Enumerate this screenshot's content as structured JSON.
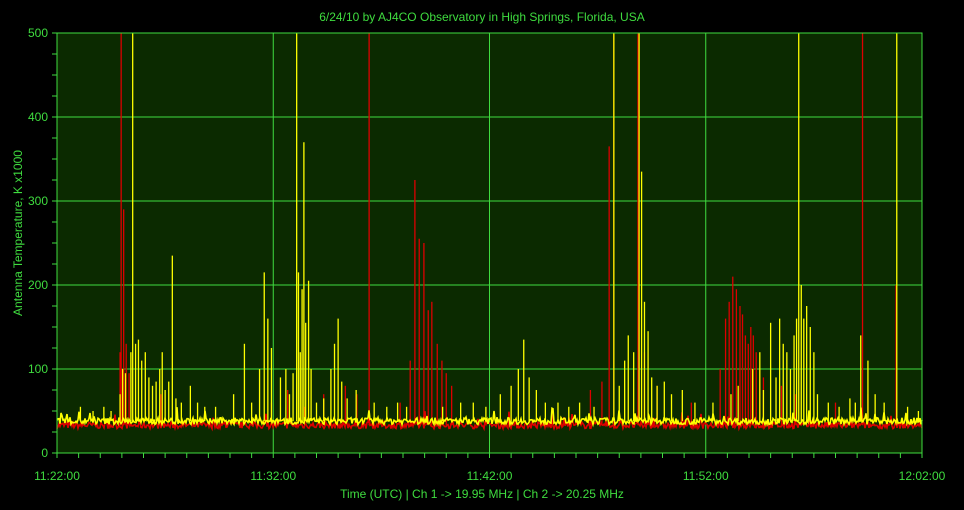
{
  "chart_data": {
    "type": "line",
    "title": "6/24/10  by  AJ4CO Observatory  in  High Springs, Florida, USA",
    "xlabel": "Time (UTC)  |  Ch 1 -> 19.95 MHz  |  Ch 2 -> 20.25 MHz",
    "ylabel": "Antenna Temperature, K x1000",
    "ylim": [
      0,
      500
    ],
    "yticks": [
      0,
      100,
      200,
      300,
      400,
      500
    ],
    "xlim": [
      "11:22:00",
      "12:02:00"
    ],
    "xticks": [
      "11:22:00",
      "11:32:00",
      "11:42:00",
      "11:52:00",
      "12:02:00"
    ],
    "grid": true,
    "background": "#0b2a00",
    "series": [
      {
        "color": "#dd0000",
        "baseline": 33,
        "points": [
          [
            "11:24:55",
            120
          ],
          [
            "11:24:58",
            500
          ],
          [
            "11:25:05",
            290
          ],
          [
            "11:25:12",
            130
          ],
          [
            "11:25:20",
            95
          ],
          [
            "11:26:15",
            75
          ],
          [
            "11:26:48",
            70
          ],
          [
            "11:31:55",
            60
          ],
          [
            "11:32:40",
            75
          ],
          [
            "11:33:28",
            55
          ],
          [
            "11:34:20",
            70
          ],
          [
            "11:35:20",
            80
          ],
          [
            "11:35:52",
            70
          ],
          [
            "11:36:26",
            500
          ],
          [
            "11:37:52",
            60
          ],
          [
            "11:38:20",
            110
          ],
          [
            "11:38:33",
            325
          ],
          [
            "11:38:45",
            255
          ],
          [
            "11:38:58",
            250
          ],
          [
            "11:39:10",
            170
          ],
          [
            "11:39:20",
            180
          ],
          [
            "11:39:35",
            130
          ],
          [
            "11:39:48",
            110
          ],
          [
            "11:40:00",
            95
          ],
          [
            "11:40:15",
            80
          ],
          [
            "11:46:40",
            75
          ],
          [
            "11:47:12",
            85
          ],
          [
            "11:47:32",
            365
          ],
          [
            "11:47:45",
            500
          ],
          [
            "11:48:52",
            500
          ],
          [
            "11:49:10",
            120
          ],
          [
            "11:49:45",
            80
          ],
          [
            "11:51:20",
            60
          ],
          [
            "11:52:40",
            100
          ],
          [
            "11:52:55",
            160
          ],
          [
            "11:53:05",
            180
          ],
          [
            "11:53:15",
            210
          ],
          [
            "11:53:25",
            195
          ],
          [
            "11:53:35",
            175
          ],
          [
            "11:53:42",
            165
          ],
          [
            "11:53:50",
            140
          ],
          [
            "11:53:58",
            130
          ],
          [
            "11:54:05",
            150
          ],
          [
            "11:54:12",
            140
          ],
          [
            "11:54:20",
            120
          ],
          [
            "11:54:30",
            100
          ],
          [
            "11:54:40",
            90
          ],
          [
            "11:55:30",
            80
          ],
          [
            "11:56:10",
            70
          ],
          [
            "11:58:00",
            60
          ],
          [
            "11:59:15",
            500
          ],
          [
            "11:59:30",
            70
          ],
          [
            "12:00:48",
            200
          ]
        ]
      },
      {
        "color": "#ffff00",
        "baseline": 38,
        "points": [
          [
            "11:23:05",
            55
          ],
          [
            "11:23:40",
            50
          ],
          [
            "11:24:10",
            55
          ],
          [
            "11:24:30",
            50
          ],
          [
            "11:24:55",
            70
          ],
          [
            "11:25:02",
            100
          ],
          [
            "11:25:10",
            95
          ],
          [
            "11:25:25",
            120
          ],
          [
            "11:25:30",
            500
          ],
          [
            "11:25:38",
            130
          ],
          [
            "11:25:46",
            135
          ],
          [
            "11:25:55",
            110
          ],
          [
            "11:26:05",
            120
          ],
          [
            "11:26:15",
            90
          ],
          [
            "11:26:25",
            80
          ],
          [
            "11:26:35",
            85
          ],
          [
            "11:26:45",
            100
          ],
          [
            "11:26:52",
            120
          ],
          [
            "11:27:00",
            75
          ],
          [
            "11:27:10",
            85
          ],
          [
            "11:27:20",
            235
          ],
          [
            "11:27:30",
            65
          ],
          [
            "11:27:45",
            60
          ],
          [
            "11:28:10",
            80
          ],
          [
            "11:28:30",
            60
          ],
          [
            "11:28:50",
            55
          ],
          [
            "11:29:20",
            55
          ],
          [
            "11:30:10",
            70
          ],
          [
            "11:30:40",
            130
          ],
          [
            "11:31:00",
            60
          ],
          [
            "11:31:22",
            100
          ],
          [
            "11:31:35",
            215
          ],
          [
            "11:31:45",
            160
          ],
          [
            "11:31:55",
            125
          ],
          [
            "11:32:20",
            90
          ],
          [
            "11:32:35",
            100
          ],
          [
            "11:32:45",
            70
          ],
          [
            "11:32:55",
            95
          ],
          [
            "11:33:05",
            500
          ],
          [
            "11:33:10",
            215
          ],
          [
            "11:33:15",
            120
          ],
          [
            "11:33:20",
            195
          ],
          [
            "11:33:25",
            370
          ],
          [
            "11:33:30",
            155
          ],
          [
            "11:33:38",
            205
          ],
          [
            "11:33:45",
            100
          ],
          [
            "11:34:00",
            60
          ],
          [
            "11:34:20",
            65
          ],
          [
            "11:34:40",
            100
          ],
          [
            "11:34:50",
            130
          ],
          [
            "11:35:00",
            160
          ],
          [
            "11:35:10",
            85
          ],
          [
            "11:35:25",
            65
          ],
          [
            "11:35:50",
            75
          ],
          [
            "11:36:40",
            60
          ],
          [
            "11:37:15",
            55
          ],
          [
            "11:37:45",
            60
          ],
          [
            "11:38:10",
            55
          ],
          [
            "11:39:50",
            55
          ],
          [
            "11:40:40",
            60
          ],
          [
            "11:41:15",
            60
          ],
          [
            "11:41:50",
            55
          ],
          [
            "11:42:30",
            70
          ],
          [
            "11:43:00",
            80
          ],
          [
            "11:43:20",
            100
          ],
          [
            "11:43:35",
            135
          ],
          [
            "11:43:50",
            90
          ],
          [
            "11:44:10",
            75
          ],
          [
            "11:44:35",
            60
          ],
          [
            "11:45:10",
            60
          ],
          [
            "11:45:40",
            55
          ],
          [
            "11:46:10",
            60
          ],
          [
            "11:46:50",
            55
          ],
          [
            "11:47:45",
            500
          ],
          [
            "11:48:00",
            80
          ],
          [
            "11:48:15",
            110
          ],
          [
            "11:48:25",
            140
          ],
          [
            "11:48:40",
            120
          ],
          [
            "11:48:55",
            500
          ],
          [
            "11:49:02",
            335
          ],
          [
            "11:49:10",
            180
          ],
          [
            "11:49:20",
            145
          ],
          [
            "11:49:30",
            90
          ],
          [
            "11:49:45",
            80
          ],
          [
            "11:50:05",
            85
          ],
          [
            "11:50:25",
            70
          ],
          [
            "11:50:55",
            75
          ],
          [
            "11:51:30",
            60
          ],
          [
            "11:52:20",
            60
          ],
          [
            "11:53:10",
            70
          ],
          [
            "11:53:30",
            80
          ],
          [
            "11:54:10",
            100
          ],
          [
            "11:54:30",
            120
          ],
          [
            "11:54:40",
            75
          ],
          [
            "11:55:00",
            155
          ],
          [
            "11:55:15",
            90
          ],
          [
            "11:55:25",
            160
          ],
          [
            "11:55:35",
            130
          ],
          [
            "11:55:45",
            120
          ],
          [
            "11:55:55",
            100
          ],
          [
            "11:56:05",
            140
          ],
          [
            "11:56:12",
            160
          ],
          [
            "11:56:18",
            500
          ],
          [
            "11:56:25",
            200
          ],
          [
            "11:56:32",
            160
          ],
          [
            "11:56:40",
            175
          ],
          [
            "11:56:50",
            150
          ],
          [
            "11:57:00",
            120
          ],
          [
            "11:57:10",
            70
          ],
          [
            "11:57:40",
            60
          ],
          [
            "11:58:10",
            55
          ],
          [
            "11:58:40",
            65
          ],
          [
            "11:58:55",
            60
          ],
          [
            "11:59:10",
            140
          ],
          [
            "11:59:30",
            110
          ],
          [
            "11:59:50",
            70
          ],
          [
            "12:00:15",
            60
          ],
          [
            "12:00:50",
            500
          ],
          [
            "12:01:20",
            55
          ],
          [
            "12:01:50",
            50
          ]
        ]
      }
    ]
  }
}
